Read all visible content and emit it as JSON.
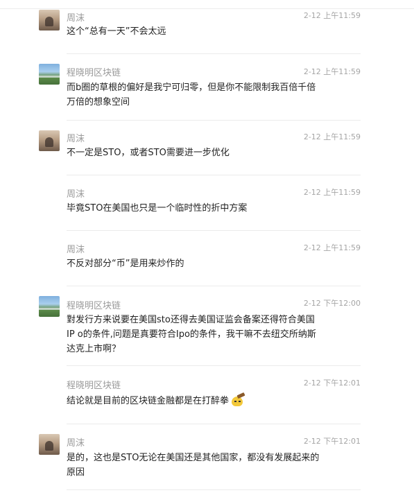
{
  "messages": [
    {
      "sender": "周沫",
      "avatar": "zhou-avatar",
      "time": "2-12 上午11:59",
      "lines": [
        "这个“总有一天”不会太远"
      ]
    },
    {
      "sender": "程晓明区块链",
      "avatar": "cheng-avatar",
      "time": "2-12 上午11:59",
      "lines": [
        "而b圈的草根的偏好是我宁可归零，但是你不能限制我百倍千倍",
        "万倍的想象空间"
      ]
    },
    {
      "sender": "周沫",
      "avatar": "zhou-avatar",
      "time": "2-12 上午11:59",
      "lines": [
        "不一定是STO，或者STO需要进一步优化"
      ]
    },
    {
      "sender": "周沫",
      "avatar": "",
      "time": "2-12 上午11:59",
      "lines": [
        "毕竟STO在美国也只是一个临时性的折中方案"
      ]
    },
    {
      "sender": "周沫",
      "avatar": "",
      "time": "2-12 上午11:59",
      "lines": [
        "不反对部分“币”是用来炒作的"
      ]
    },
    {
      "sender": "程晓明区块链",
      "avatar": "cheng-avatar",
      "time": "2-12 下午12:00",
      "lines": [
        "對发行方来说要在美国sto还得去美国证监会备案还得符合美国",
        "IP o的条件,问题是真要符合Ipo的条件，我干嘛不去纽交所纳斯",
        "达克上市啊？"
      ]
    },
    {
      "sender": "程晓明区块链",
      "avatar": "",
      "time": "2-12 下午12:01",
      "lines": [
        "结论就是目前的区块链金融都是在打醉拳"
      ],
      "emoji": "hammer-face-emoji"
    },
    {
      "sender": "周沫",
      "avatar": "zhou-avatar",
      "time": "2-12 下午12:01",
      "lines": [
        "是的，这也是STO无论在美国还是其他国家，都没有发展起来的",
        "原因"
      ]
    }
  ]
}
